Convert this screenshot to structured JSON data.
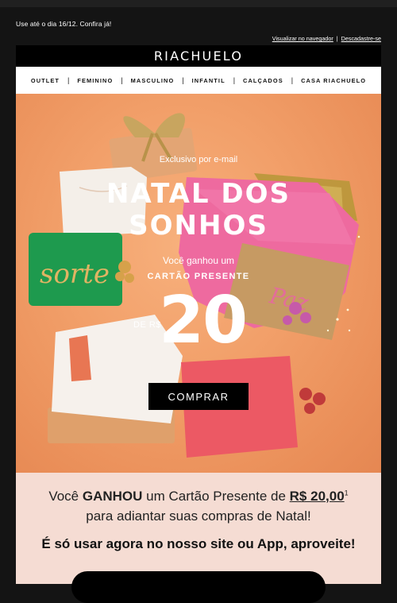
{
  "preheader": {
    "text": "Use até o dia 16/12. Confira já!"
  },
  "header_links": {
    "view_browser": "Visualizar no navegador",
    "separator": "|",
    "unsubscribe": "Descadastre-se"
  },
  "brand": {
    "logo": "RIACHUELO"
  },
  "nav": {
    "items": [
      "OUTLET",
      "FEMININO",
      "MASCULINO",
      "INFANTIL",
      "CALÇADOS",
      "CASA RIACHUELO"
    ],
    "separator": "|"
  },
  "hero": {
    "exclusive": "Exclusivo por e-mail",
    "title_line1": "NATAL DOS",
    "title_line2": "SONHOS",
    "won": "Você ganhou um",
    "gift_card": "CARTÃO PRESENTE",
    "currency_prefix": "DE R$",
    "amount": "20",
    "cta": "COMPRAR",
    "pouch_left_word": "sorte",
    "pouch_right_word": "Paz"
  },
  "promo": {
    "text_a": "Você ",
    "text_b": "GANHOU",
    "text_c": " um Cartão Presente de ",
    "amount": "R$ 20,00",
    "footnote": "1",
    "line2": "para adiantar suas compras de Natal!",
    "line3": "É só usar agora no nosso site ou App, aproveite!"
  },
  "colors": {
    "page_bg": "#141414",
    "hero_bg": "#f2a06a",
    "promo_bg": "#f5dcd3",
    "accent_green": "#1e9a4e",
    "accent_pink": "#ee5f95",
    "accent_red": "#ec5964"
  }
}
